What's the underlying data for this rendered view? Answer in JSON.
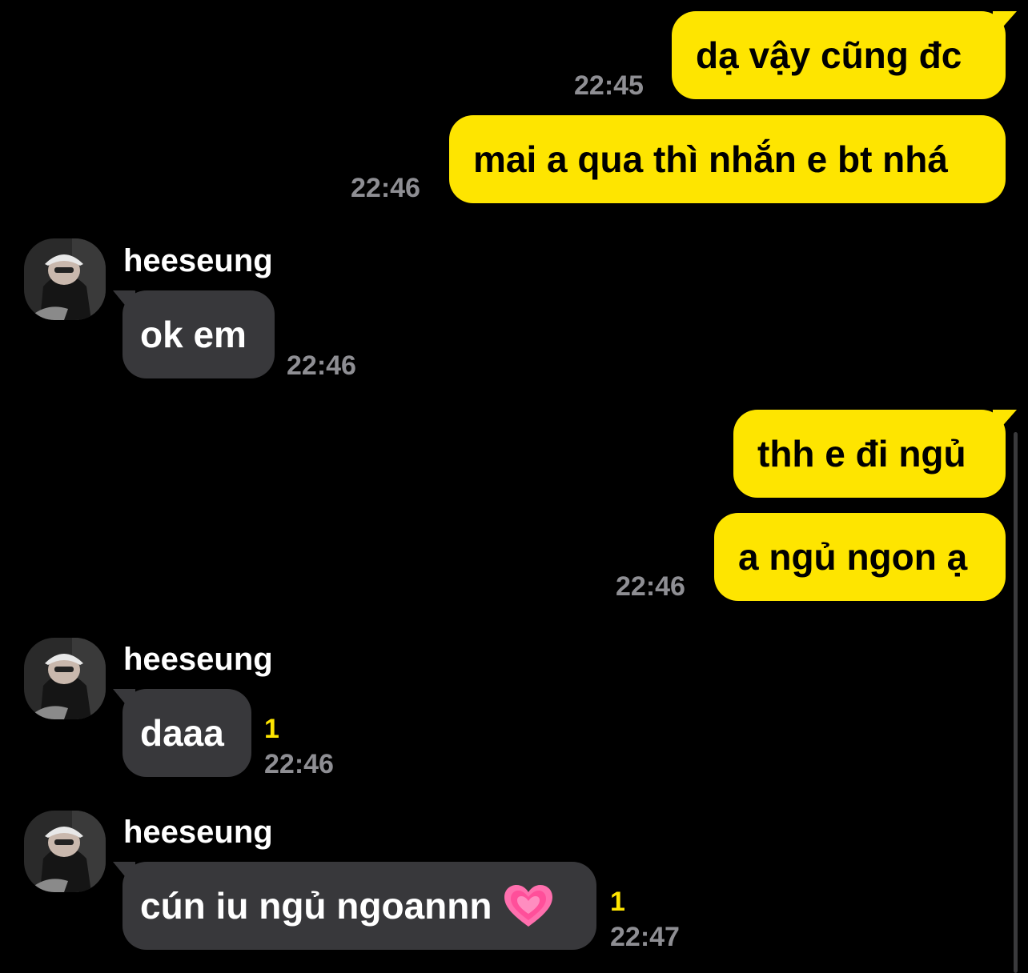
{
  "messages": [
    {
      "direction": "out",
      "text": "dạ vậy cũng đc",
      "time": "22:45"
    },
    {
      "direction": "out",
      "text": "mai a qua thì nhắn e bt nhá",
      "time": "22:46"
    },
    {
      "direction": "in",
      "sender": "heeseung",
      "text": "ok em",
      "time": "22:46"
    },
    {
      "direction": "out",
      "text": "thh e đi ngủ",
      "time": ""
    },
    {
      "direction": "out",
      "text": "a ngủ ngon ạ",
      "time": "22:46"
    },
    {
      "direction": "in",
      "sender": "heeseung",
      "text": "daaa",
      "time": "22:46",
      "unread": "1"
    },
    {
      "direction": "in",
      "sender": "heeseung",
      "text": "cún iu ngủ ngoannn",
      "emoji": "heart-icon",
      "time": "22:47",
      "unread": "1"
    }
  ],
  "colors": {
    "background": "#000000",
    "outgoing_bubble": "#FEE500",
    "incoming_bubble": "#38383B",
    "timestamp": "#8E8E93",
    "unread_count": "#FEE500"
  }
}
